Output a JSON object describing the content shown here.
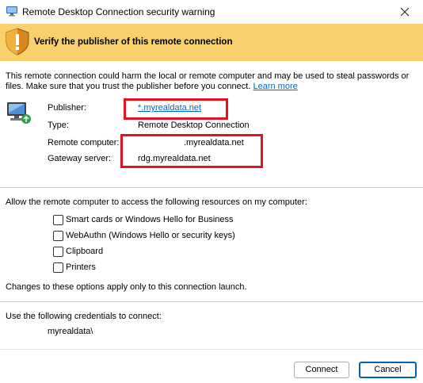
{
  "window": {
    "title": "Remote Desktop Connection security warning"
  },
  "banner": {
    "text": "Verify the publisher of this remote connection"
  },
  "description": {
    "line1": "This remote connection could harm the local or remote computer and may be used to steal passwords or",
    "line2": "files. Make sure that you trust the publisher before you connect.",
    "learn_more": "Learn more"
  },
  "info": {
    "publisher_label": "Publisher:",
    "publisher_value": "*.myrealdata.net",
    "type_label": "Type:",
    "type_value": "Remote Desktop Connection",
    "remote_label": "Remote computer:",
    "remote_value": ".myrealdata.net",
    "gateway_label": "Gateway server:",
    "gateway_value": "rdg.myrealdata.net"
  },
  "resources": {
    "heading": "Allow the remote computer to access the following resources on my computer:",
    "options": [
      {
        "label": "Smart cards or Windows Hello for Business",
        "checked": false
      },
      {
        "label": "WebAuthn (Windows Hello or security keys)",
        "checked": false
      },
      {
        "label": "Clipboard",
        "checked": false
      },
      {
        "label": "Printers",
        "checked": false
      }
    ],
    "note": "Changes to these options apply only to this connection launch."
  },
  "credentials": {
    "heading": "Use the following credentials to connect:",
    "username": "myrealdata\\"
  },
  "buttons": {
    "connect": "Connect",
    "cancel": "Cancel"
  },
  "colors": {
    "banner": "#f8d16c",
    "highlight": "#e3121f",
    "link": "#0066cc",
    "primary_border": "#005fb8"
  }
}
